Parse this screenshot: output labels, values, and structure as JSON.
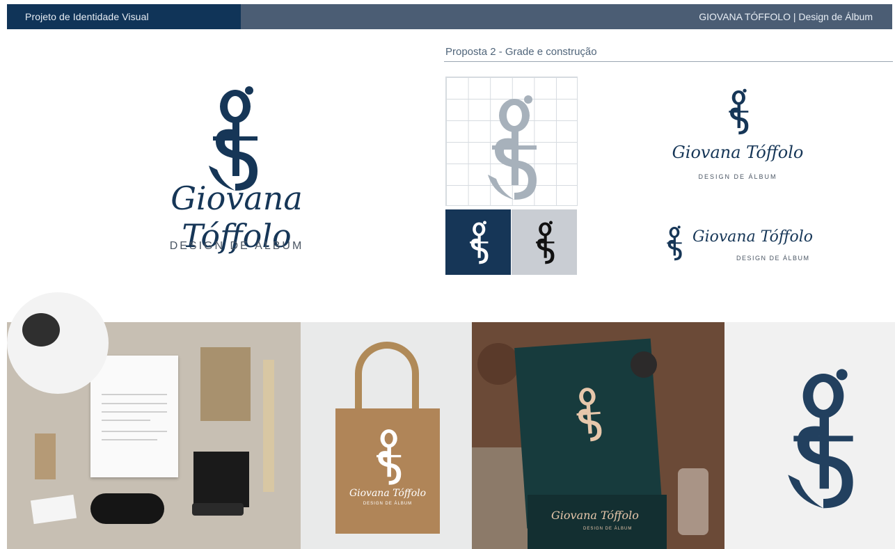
{
  "header": {
    "left_title": "Projeto de Identidade Visual",
    "right_title": "GIOVANA TÓFFOLO  |  Design de Álbum"
  },
  "section": {
    "title": "Proposta 2 - Grade e construção"
  },
  "brand": {
    "monogram": "gS",
    "name": "Giovana Tóffolo",
    "tagline": "DESIGN DE ÁLBUM"
  },
  "colors": {
    "navy": "#163657",
    "header_bar": "#4b5d74",
    "header_left": "#103458",
    "light_tile": "#c9cdd3",
    "grid_mark": "#a7b1bb"
  },
  "mockups": {
    "panels": [
      "stationery-mockup",
      "tote-bag-mockup",
      "hang-tag-mockup",
      "embossed-paper-mockup"
    ]
  }
}
